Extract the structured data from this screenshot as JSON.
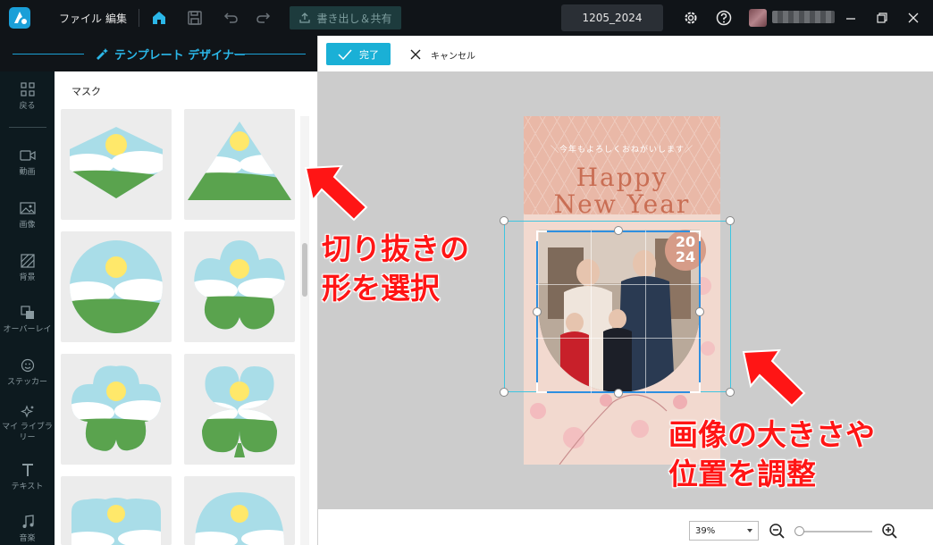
{
  "titlebar": {
    "menu_file": "ファイル",
    "menu_edit": "編集",
    "export_label": "書き出し＆共有",
    "project_name": "1205_2024"
  },
  "left_header": {
    "title": "テンプレート デザイナー"
  },
  "rail": {
    "items": [
      {
        "label": "戻る",
        "icon": "grid-icon"
      },
      {
        "label": "動画",
        "icon": "video-icon"
      },
      {
        "label": "画像",
        "icon": "image-icon"
      },
      {
        "label": "背景",
        "icon": "background-icon"
      },
      {
        "label": "オーバーレイ",
        "icon": "overlay-icon"
      },
      {
        "label": "ステッカー",
        "icon": "sticker-icon"
      },
      {
        "label": "マイ ライブラリー",
        "icon": "sparkle-icon"
      },
      {
        "label": "テキスト",
        "icon": "text-icon"
      },
      {
        "label": "音楽",
        "icon": "music-icon"
      }
    ]
  },
  "panel": {
    "title": "マスク",
    "masks": [
      "hexagon-diamond",
      "triangle",
      "circle",
      "flower",
      "blob-flower",
      "clover",
      "arch",
      "dome"
    ]
  },
  "toolbar2": {
    "done_label": "完了",
    "cancel_label": "キャンセル"
  },
  "card": {
    "subtitle": "＼今年もよろしくおねがいします／",
    "happy": "Happy",
    "new_year": "New Year",
    "year_top": "20",
    "year_bottom": "24"
  },
  "bottom": {
    "zoom": "39%"
  },
  "annotations": {
    "left_line1": "切り抜きの",
    "left_line2": "形を選択",
    "right_line1": "画像の大きさや",
    "right_line2": "位置を調整"
  },
  "colors": {
    "accent": "#1ab0d6",
    "titlebar": "#101418",
    "annotation": "#ff1515"
  }
}
